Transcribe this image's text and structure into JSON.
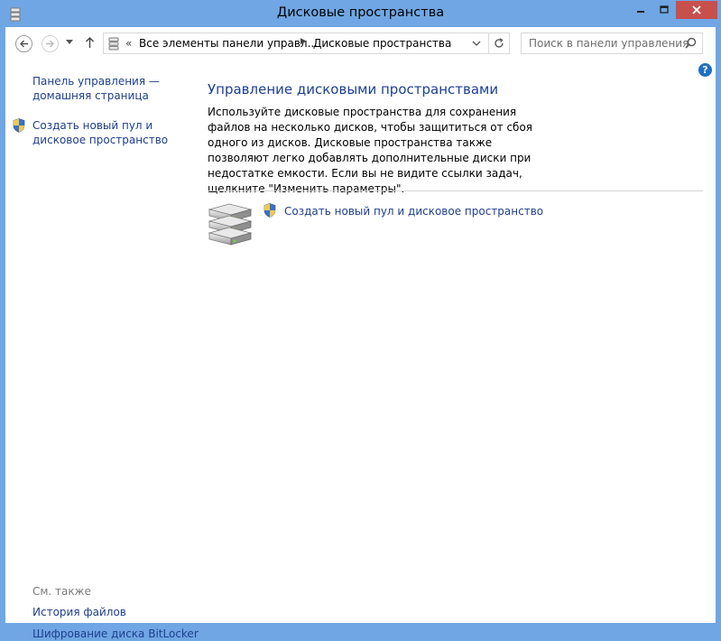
{
  "window": {
    "title": "Дисковые пространства",
    "title_icon": "storage-spaces-icon",
    "controls": [
      "minimize-icon",
      "maximize-icon",
      "close-icon"
    ]
  },
  "nav": {
    "back_icon": "back-arrow-icon",
    "forward_icon": "forward-arrow-icon",
    "recent_icon": "chevron-down-icon",
    "up_icon": "up-arrow-icon",
    "address": {
      "prefix": "«",
      "segments": [
        "Все элементы панели управл...",
        "Дисковые пространства"
      ],
      "separator": "▶"
    },
    "refresh_icon": "refresh-icon",
    "search": {
      "placeholder": "Поиск в панели управления",
      "icon": "search-icon"
    }
  },
  "help_label": "?",
  "left_pane": {
    "home_link": "Панель управления — домашняя страница",
    "create_link": "Создать новый пул и дисковое пространство",
    "see_also_title": "См. также",
    "see_also": [
      "История файлов",
      "Шифрование диска BitLocker"
    ]
  },
  "main": {
    "title": "Управление дисковыми пространствами",
    "description": "Используйте дисковые пространства для сохранения файлов на несколько дисков, чтобы защититься от сбоя одного из дисков. Дисковые пространства также позволяют легко добавлять дополнительные диски при недостатке емкости. Если вы не видите ссылки задач, щелкните \"Изменить параметры\".",
    "task_link": "Создать новый пул и дисковое пространство",
    "drives_icon": "storage-drives-icon",
    "shield_icon": "uac-shield-icon"
  },
  "colors": {
    "frame": "#6fa6e3",
    "link": "#1e3f8f",
    "title": "#1c3f94",
    "close": "#c7504c"
  }
}
